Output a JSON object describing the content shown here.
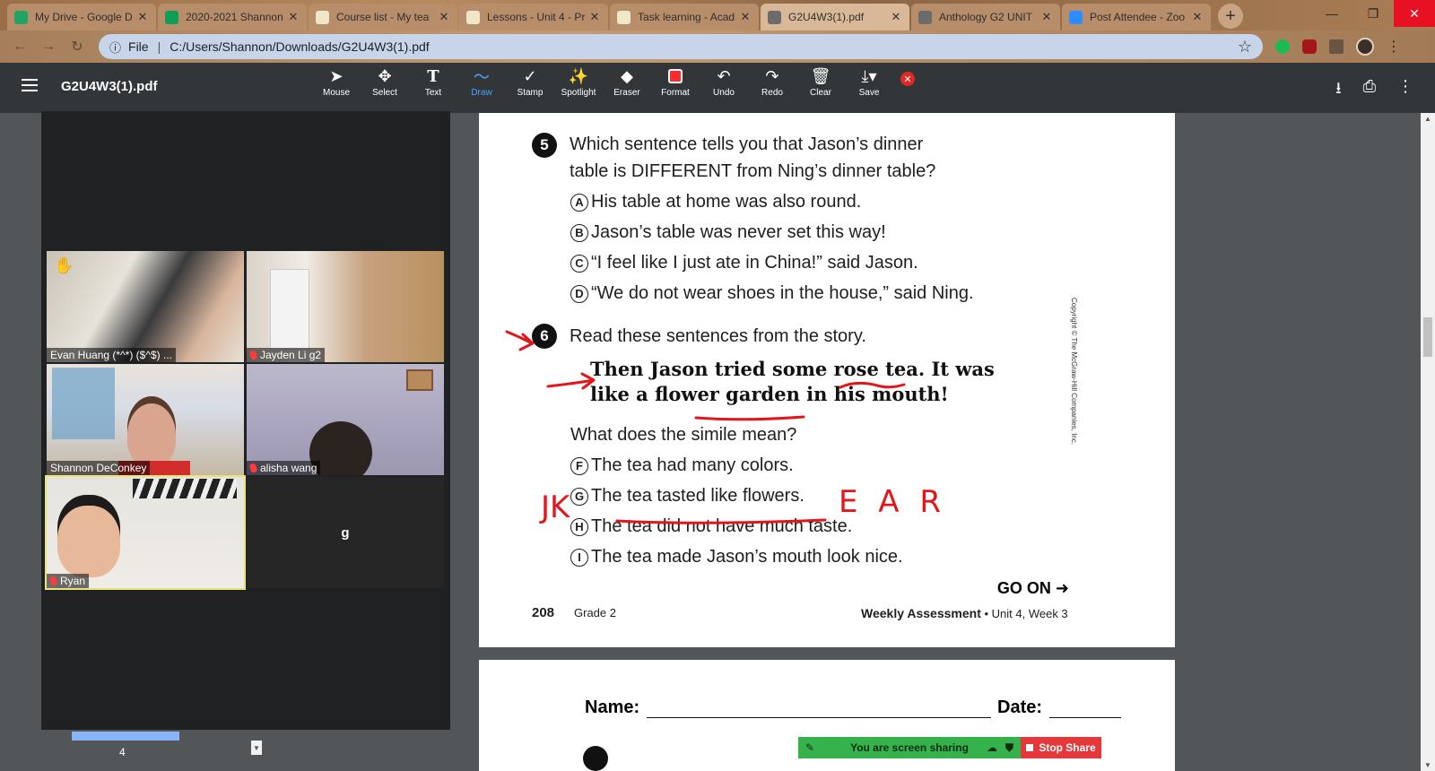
{
  "browser": {
    "tabs": [
      {
        "title": "My Drive - Google D",
        "icon": "google-drive-icon",
        "color": "#1fa463"
      },
      {
        "title": "2020-2021 Shannon",
        "icon": "sheets-icon",
        "color": "#0f9d58"
      },
      {
        "title": "Course list - My tea",
        "icon": "doc-icon",
        "color": "#f0e6c8"
      },
      {
        "title": "Lessons - Unit 4 - Pr",
        "icon": "doc-icon",
        "color": "#f0e6c8"
      },
      {
        "title": "Task learning - Acad",
        "icon": "doc-icon",
        "color": "#f0e6c8"
      },
      {
        "title": "G2U4W3(1).pdf",
        "icon": "globe-icon",
        "color": "#6b6b6b"
      },
      {
        "title": "Anthology G2 UNIT",
        "icon": "globe-icon",
        "color": "#6b6b6b"
      },
      {
        "title": "Post Attendee - Zoo",
        "icon": "zoom-icon",
        "color": "#2d8cff"
      }
    ],
    "active_tab": 5,
    "address": {
      "scheme_label": "File",
      "url": "C:/Users/Shannon/Downloads/G2U4W3(1).pdf"
    }
  },
  "pdf_viewer": {
    "file_title": "G2U4W3(1).pdf"
  },
  "annotation_toolbar": {
    "tools": [
      "Mouse",
      "Select",
      "Text",
      "Draw",
      "Stamp",
      "Spotlight",
      "Eraser",
      "Format",
      "Undo",
      "Redo",
      "Clear",
      "Save"
    ],
    "selected": "Draw"
  },
  "gallery": {
    "participants": [
      {
        "name": "Evan Huang (*^*) ($^$) ...",
        "muted": false
      },
      {
        "name": "Jayden Li g2",
        "muted": true
      },
      {
        "name": "Shannon DeConkey",
        "muted": false
      },
      {
        "name": "alisha wang",
        "muted": true
      },
      {
        "name": "Ryan",
        "muted": true
      },
      {
        "name": "g",
        "muted": false
      }
    ],
    "thumbnail_page": "4"
  },
  "document": {
    "q5": {
      "number": "5",
      "line1": "Which sentence tells you that Jason’s dinner",
      "line2": "table is DIFFERENT from Ning’s dinner table?",
      "options": [
        {
          "letter": "A",
          "text": "His table at home was also round."
        },
        {
          "letter": "B",
          "text": "Jason’s table was never set this way!"
        },
        {
          "letter": "C",
          "text": "“I feel like I just ate in China!” said Jason."
        },
        {
          "letter": "D",
          "text": "“We do not wear shoes in the house,” said Ning."
        }
      ]
    },
    "q6": {
      "number": "6",
      "prompt": "Read these sentences from the story.",
      "quote_line1": "Then Jason tried some rose tea. It was",
      "quote_line2": "like a flower garden in his mouth!",
      "question": "What does the simile mean?",
      "options": [
        {
          "letter": "F",
          "text": "The tea had many colors."
        },
        {
          "letter": "G",
          "text": "The tea tasted like flowers."
        },
        {
          "letter": "H",
          "text": "The tea did not have much taste."
        },
        {
          "letter": "I",
          "text": "The tea made Jason’s mouth look nice."
        }
      ]
    },
    "go_on": "GO ON ➜",
    "page_number": "208",
    "grade": "Grade 2",
    "assessment_bold": "Weekly Assessment",
    "assessment_rest": " • Unit 4, Week 3",
    "copyright": "Copyright © The McGraw-Hill Companies, Inc.",
    "next_page": {
      "name_label": "Name:",
      "date_label": "Date:"
    }
  },
  "annotations": {
    "ink_color": "#e3161b",
    "initials": [
      "JK",
      "E A R"
    ]
  },
  "share_banner": {
    "status": "You are screen sharing",
    "stop_label": "Stop Share"
  }
}
